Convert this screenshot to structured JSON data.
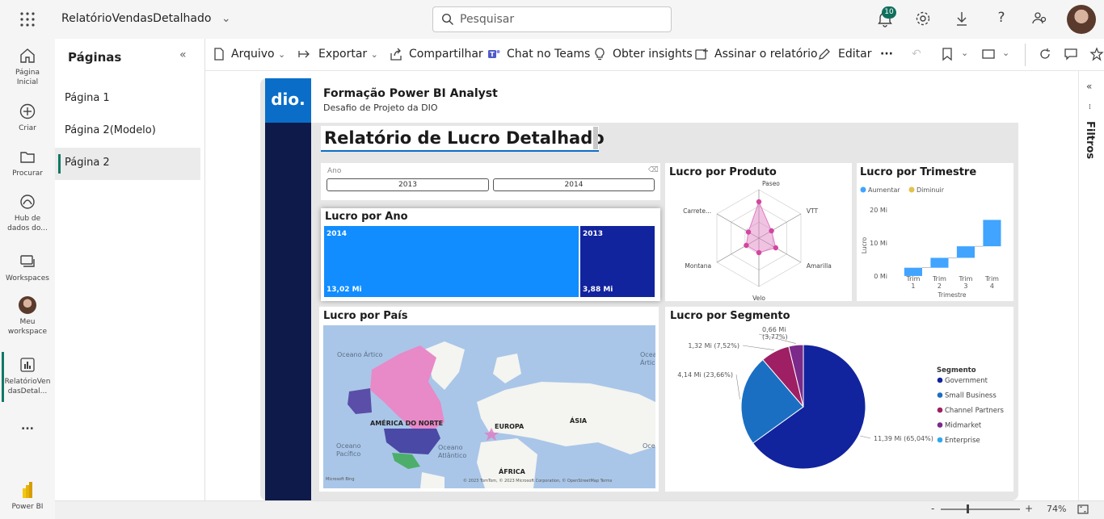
{
  "topbar": {
    "app_title": "RelatórioVendasDetalhado",
    "search_placeholder": "Pesquisar",
    "notifications_count": "10"
  },
  "leftnav": {
    "items": [
      {
        "label": "Página Inicial",
        "icon": "home-icon"
      },
      {
        "label": "Criar",
        "icon": "plus-circle-icon"
      },
      {
        "label": "Procurar",
        "icon": "folder-icon"
      },
      {
        "label": "Hub de dados do...",
        "icon": "data-hub-icon"
      },
      {
        "label": "Workspaces",
        "icon": "workspaces-icon"
      },
      {
        "label": "Meu workspace",
        "icon": "avatar-icon"
      },
      {
        "label": "RelatórioVendasDetal...",
        "icon": "report-icon"
      },
      {
        "label": "...",
        "icon": "more-icon"
      },
      {
        "label": "Power BI",
        "icon": "powerbi-logo-icon"
      }
    ]
  },
  "pages": {
    "title": "Páginas",
    "items": [
      "Página 1",
      "Página 2(Modelo)",
      "Página 2"
    ],
    "selected": "Página 2"
  },
  "toolbar": {
    "arquivo": "Arquivo",
    "exportar": "Exportar",
    "compartilhar": "Compartilhar",
    "chat": "Chat no Teams",
    "insights": "Obter insights",
    "assinar": "Assinar o relatório",
    "editar": "Editar",
    "more": "···"
  },
  "filters": {
    "label": "Filtros"
  },
  "status": {
    "zoom": "74%",
    "minus": "-",
    "plus": "+"
  },
  "report": {
    "logo": "dio.",
    "title": "Formação Power BI Analyst",
    "subtitle": "Desafio de Projeto da DIO",
    "heading": "Relatório de Lucro Detalhado",
    "slicer": {
      "label": "Ano",
      "options": [
        "2013",
        "2014"
      ]
    },
    "cards": {
      "lucro_ano": "Lucro por Ano",
      "lucro_produto": "Lucro por Produto",
      "lucro_trimestre": "Lucro por Trimestre",
      "lucro_pais": "Lucro por País",
      "lucro_segmento": "Lucro por Segmento"
    },
    "map": {
      "labels": [
        "Oceano Ártico",
        "Oceano Ártico",
        "AMÉRICA DO NORTE",
        "EUROPA",
        "ÁSIA",
        "Oceano Pacífico",
        "Oceano Atlântico",
        "ÁFRICA",
        "Oceano"
      ],
      "attribution": "© 2023 TomTom, © 2023 Microsoft Corporation, © OpenStreetMap  Terms",
      "bing": "Microsoft Bing"
    }
  },
  "chart_data": [
    {
      "type": "treemap",
      "title": "Lucro por Ano",
      "categories": [
        "2014",
        "2013"
      ],
      "values": [
        13.02,
        3.88
      ],
      "value_labels": [
        "13,02 Mi",
        "3,88 Mi"
      ],
      "colors": [
        "#118dff",
        "#12239e"
      ]
    },
    {
      "type": "radar",
      "title": "Lucro por Produto",
      "categories": [
        "Paseo",
        "VTT",
        "Amarilla",
        "Velo",
        "Montana",
        "Carrete..."
      ],
      "values": [
        0.75,
        0.3,
        0.4,
        0.3,
        0.3,
        0.25
      ],
      "color": "#e07ac2"
    },
    {
      "type": "waterfall",
      "title": "Lucro por Trimestre",
      "legend": [
        "Aumentar",
        "Diminuir"
      ],
      "legend_colors": [
        "#41a4ff",
        "#e3c14a"
      ],
      "categories": [
        "Trim 1",
        "Trim 2",
        "Trim 3",
        "Trim 4"
      ],
      "start": [
        0,
        2.5,
        5.5,
        9
      ],
      "end": [
        2.5,
        5.5,
        9,
        17
      ],
      "xlabel": "Trimestre",
      "ylabel": "Lucro",
      "yticks": [
        "20 Mi",
        "10 Mi",
        "0 Mi"
      ],
      "ylim": [
        -1,
        22
      ]
    },
    {
      "type": "pie",
      "title": "Lucro por Segmento",
      "legend_title": "Segmento",
      "categories": [
        "Government",
        "Small Business",
        "Channel Partners",
        "Midmarket",
        "Enterprise"
      ],
      "values": [
        11.39,
        4.14,
        1.32,
        0.66,
        0.0
      ],
      "labels": [
        "11,39 Mi (65,04%)",
        "4,14 Mi (23,66%)",
        "1,32 Mi (7,52%)",
        "0,66 Mi (3,77%)",
        ""
      ],
      "colors": [
        "#12239e",
        "#1a6fc2",
        "#9e1f63",
        "#7b2a8a",
        "#2ea7f0"
      ]
    }
  ]
}
